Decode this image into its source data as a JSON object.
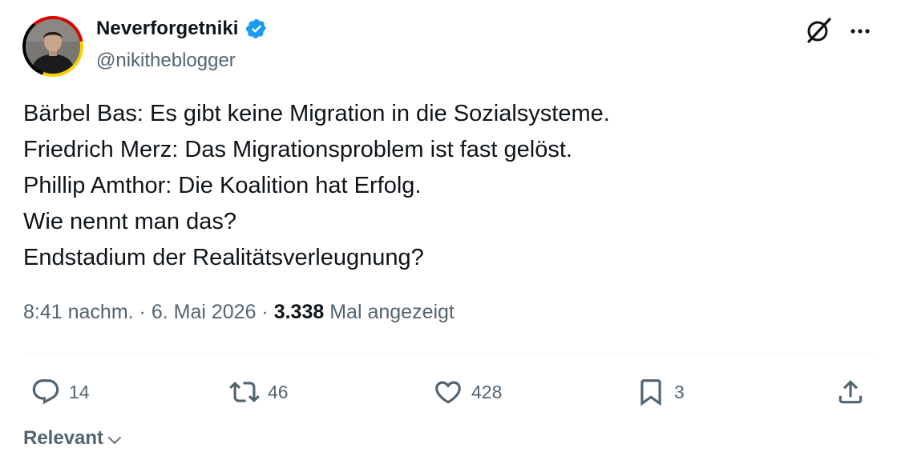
{
  "author": {
    "display_name": "Neverforgetniki",
    "handle": "@nikitheblogger",
    "verified": true
  },
  "tweet": {
    "lines": [
      "Bärbel Bas: Es gibt keine Migration in die Sozialsysteme.",
      "Friedrich Merz: Das Migrationsproblem ist fast gelöst.",
      "Phillip Amthor: Die Koalition hat Erfolg.",
      "Wie nennt man das?",
      "Endstadium der Realitätsverleugnung?"
    ]
  },
  "meta": {
    "time": "8:41 nachm.",
    "separator": "·",
    "date": "6. Mai 2026",
    "views_count": "3.338",
    "views_label": "Mal angezeigt"
  },
  "actions": {
    "replies": "14",
    "reposts": "46",
    "likes": "428",
    "bookmarks": "3"
  },
  "sort": {
    "label": "Relevant"
  },
  "colors": {
    "verified": "#1d9bf0",
    "secondary_text": "#536471",
    "primary_text": "#0f1419",
    "divider": "#eff3f4"
  }
}
